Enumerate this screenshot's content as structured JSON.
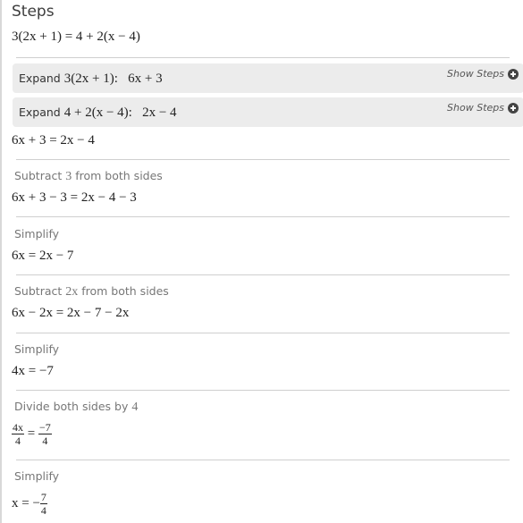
{
  "title": "Steps",
  "equation": "3(2x + 1) = 4 + 2(x − 4)",
  "expand_boxes": [
    {
      "prefix": "Expand",
      "expr": "3(2x + 1)",
      "result": "6x + 3",
      "show_steps": "Show Steps",
      "icon": "plus-circle-icon"
    },
    {
      "prefix": "Expand",
      "expr": "4 + 2(x − 4)",
      "result": "2x − 4",
      "show_steps": "Show Steps",
      "icon": "plus-circle-icon"
    }
  ],
  "expanded_equation": "6x + 3 = 2x − 4",
  "steps": [
    {
      "label_pre": "Subtract",
      "label_math": "3",
      "label_post": "from both sides",
      "expr": "6x + 3 − 3 = 2x − 4 − 3"
    },
    {
      "label_pre": "Simplify",
      "label_math": "",
      "label_post": "",
      "expr": "6x = 2x − 7"
    },
    {
      "label_pre": "Subtract",
      "label_math": "2x",
      "label_post": "from both sides",
      "expr": "6x − 2x = 2x − 7 − 2x"
    },
    {
      "label_pre": "Simplify",
      "label_math": "",
      "label_post": "",
      "expr": "4x = −7"
    },
    {
      "label_pre": "Divide both sides by",
      "label_math": "4",
      "label_post": "",
      "frac_left": {
        "num": "4x",
        "den": "4"
      },
      "frac_right": {
        "num": "−7",
        "den": "4"
      }
    },
    {
      "label_pre": "Simplify",
      "label_math": "",
      "label_post": "",
      "lhs": "x = −",
      "frac": {
        "num": "7",
        "den": "4"
      }
    }
  ]
}
